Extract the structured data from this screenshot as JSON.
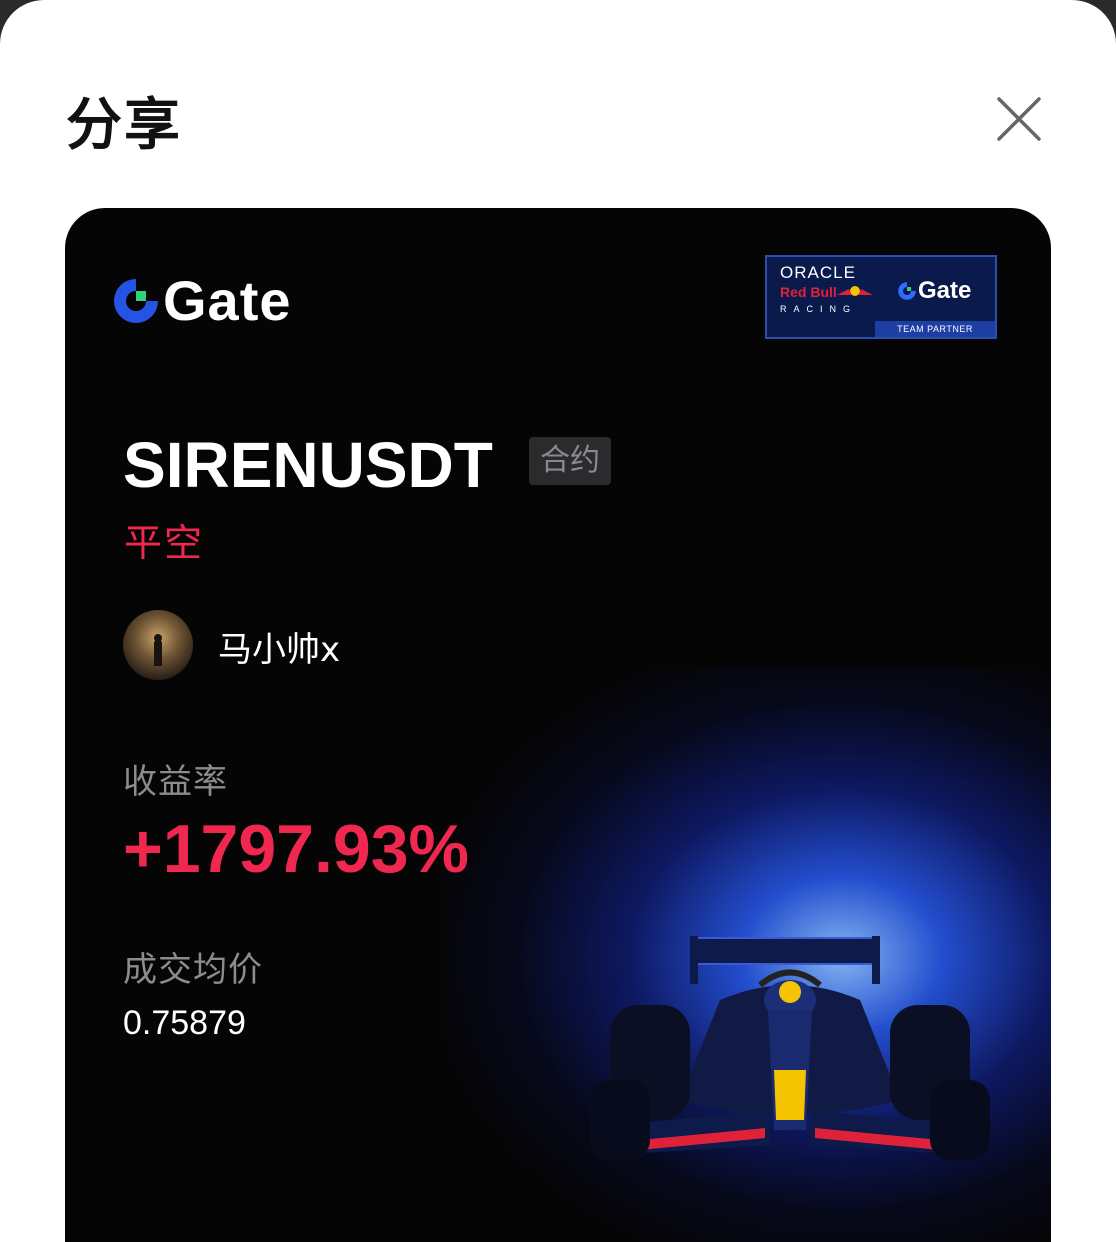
{
  "sheet": {
    "title": "分享",
    "close_icon": "close-icon"
  },
  "card": {
    "brand": {
      "logo_icon": "gate-logo-icon",
      "name": "Gate"
    },
    "partner": {
      "line1": "ORACLE",
      "line2": "Red Bull",
      "line3": "RACING",
      "brand": "Gate",
      "footer": "TEAM PARTNER"
    },
    "symbol": "SIRENUSDT",
    "contract_tag": "合约",
    "direction": "平空",
    "user": {
      "name": "马小帅x",
      "avatar_icon": "avatar-image"
    },
    "yield_label": "收益率",
    "yield_value": "+1797.93%",
    "avg_price_label": "成交均价",
    "avg_price_value": "0.75879",
    "illustration": "f1-race-car-image",
    "colors": {
      "accent_red": "#f0284f",
      "brand_blue": "#2354e6",
      "brand_green": "#2ed37a",
      "card_bg": "#050506"
    }
  }
}
